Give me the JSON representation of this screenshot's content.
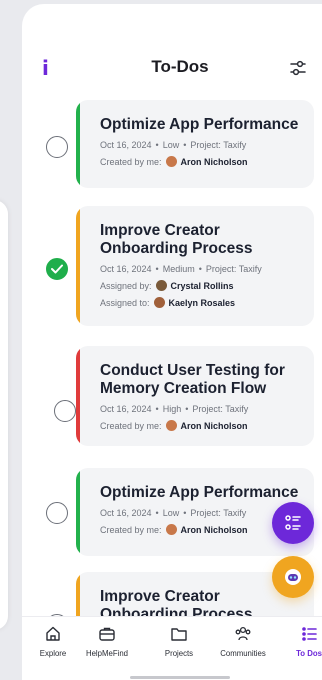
{
  "header": {
    "title": "To-Dos",
    "brand_glyph": "i"
  },
  "tasks": [
    {
      "title": "Optimize App Performance",
      "date": "Oct 16, 2024",
      "priority": "Low",
      "project": "Project: Taxify",
      "completed": false,
      "accent": "#22b14c",
      "people": [
        {
          "role": "Created by me:",
          "name": "Aron Nicholson"
        }
      ]
    },
    {
      "title": "Improve Creator Onboarding Process",
      "date": "Oct 16, 2024",
      "priority": "Medium",
      "project": "Project: Taxify",
      "completed": true,
      "accent": "#f0a520",
      "people": [
        {
          "role": "Assigned by:",
          "name": "Crystal Rollins"
        },
        {
          "role": "Assigned to:",
          "name": "Kaelyn Rosales"
        }
      ]
    },
    {
      "title": "Conduct User Testing for Memory Creation Flow",
      "date": "Oct 16, 2024",
      "priority": "High",
      "project": "Project: Taxify",
      "completed": false,
      "accent": "#e03b3b",
      "people": [
        {
          "role": "Created by me:",
          "name": "Aron Nicholson"
        }
      ]
    },
    {
      "title": "Optimize App Performance",
      "date": "Oct 16, 2024",
      "priority": "Low",
      "project": "Project: Taxify",
      "completed": false,
      "accent": "#22b14c",
      "people": [
        {
          "role": "Created by me:",
          "name": "Aron Nicholson"
        }
      ]
    },
    {
      "title": "Improve Creator Onboarding Process",
      "date": "",
      "priority": "",
      "project": "",
      "completed": false,
      "accent": "#f0a520",
      "people": []
    }
  ],
  "tabs": [
    {
      "label": "Explore",
      "icon": "compass-icon",
      "active": false
    },
    {
      "label": "HelpMeFind",
      "icon": "briefcase-icon",
      "active": false
    },
    {
      "label": "Projects",
      "icon": "folder-icon",
      "active": false
    },
    {
      "label": "Communities",
      "icon": "people-icon",
      "active": false
    },
    {
      "label": "To Dos",
      "icon": "todo-list-icon",
      "active": true
    }
  ],
  "colors": {
    "brand": "#6d28d9",
    "orange": "#f0a520"
  }
}
